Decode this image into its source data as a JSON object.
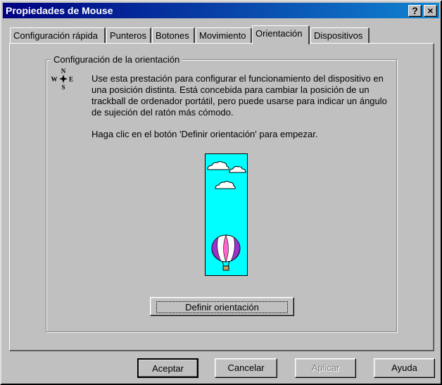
{
  "window": {
    "title": "Propiedades de Mouse"
  },
  "titlebar_buttons": {
    "help": "?",
    "close": "×"
  },
  "tabs": [
    {
      "label": "Configuración rápida"
    },
    {
      "label": "Punteros"
    },
    {
      "label": "Botones"
    },
    {
      "label": "Movimiento"
    },
    {
      "label": "Orientación",
      "active": true
    },
    {
      "label": "Dispositivos"
    }
  ],
  "orientation": {
    "group_label": "Configuración de la orientación",
    "compass": {
      "n": "N",
      "s": "S",
      "e": "E",
      "w": "W"
    },
    "description": "Use esta prestación para configurar el funcionamiento del dispositivo en una posición distinta. Está concebida para cambiar la posición de un trackball de ordenador portátil, pero puede usarse para indicar un ángulo de sujeción del ratón más cómodo.",
    "hint": "Haga clic en el botón 'Definir orientación' para empezar.",
    "define_button": "Definir orientación"
  },
  "footer": {
    "accept": "Aceptar",
    "cancel": "Cancelar",
    "apply": "Aplicar",
    "help": "Ayuda"
  },
  "colors": {
    "title_start": "#000080",
    "title_end": "#1084d0",
    "sky": "#00ffff",
    "balloon": "#9933cc",
    "face": "#c0c0c0"
  }
}
